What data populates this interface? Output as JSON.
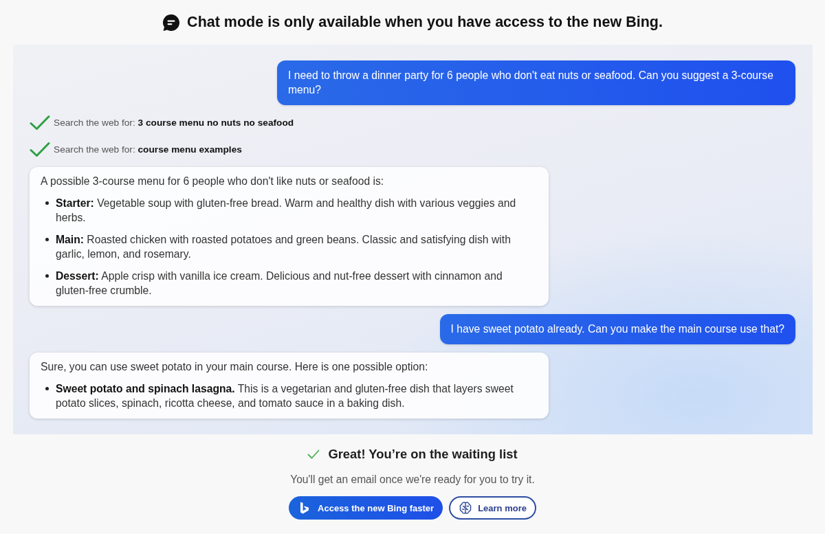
{
  "header": {
    "title": "Chat mode is only available when you have access to the new Bing."
  },
  "conversation": [
    {
      "kind": "user",
      "text": "I need to throw a dinner party for 6 people who don't eat nuts or seafood. Can you suggest a 3-course menu?"
    },
    {
      "kind": "search",
      "text": "Search the web for: **3 course menu no nuts no seafood**"
    },
    {
      "kind": "search",
      "text": "Search the web for: **course menu examples**"
    },
    {
      "kind": "bot",
      "intro": "A possible 3-course menu for 6 people who don't like nuts or seafood is:",
      "items": [
        "**Starter:** Vegetable soup with gluten-free bread. Warm and healthy dish with various veggies and herbs.",
        "**Main:** Roasted chicken with roasted potatoes and green beans. Classic and satisfying dish with garlic, lemon, and rosemary.",
        "**Dessert:** Apple crisp with vanilla ice cream. Delicious and nut-free dessert with cinnamon and gluten-free crumble."
      ]
    },
    {
      "kind": "user",
      "text": "I have sweet potato already. Can you make the main course use that?"
    },
    {
      "kind": "bot",
      "intro": "Sure, you can use sweet potato in your main course. Here is one possible option:",
      "items": [
        "**Sweet potato and spinach lasagna.** This is a vegetarian and gluten-free dish that layers sweet potato slices, spinach, ricotta cheese, and tomato sauce in a baking dish."
      ]
    }
  ],
  "waitlist": {
    "title": "Great! You’re on the waiting list",
    "subtitle": "You'll get an email once we're ready for you to try it.",
    "buttons": [
      {
        "kind": "primary",
        "label": "Access the new Bing faster"
      },
      {
        "kind": "secondary",
        "label": "Learn more"
      }
    ]
  }
}
